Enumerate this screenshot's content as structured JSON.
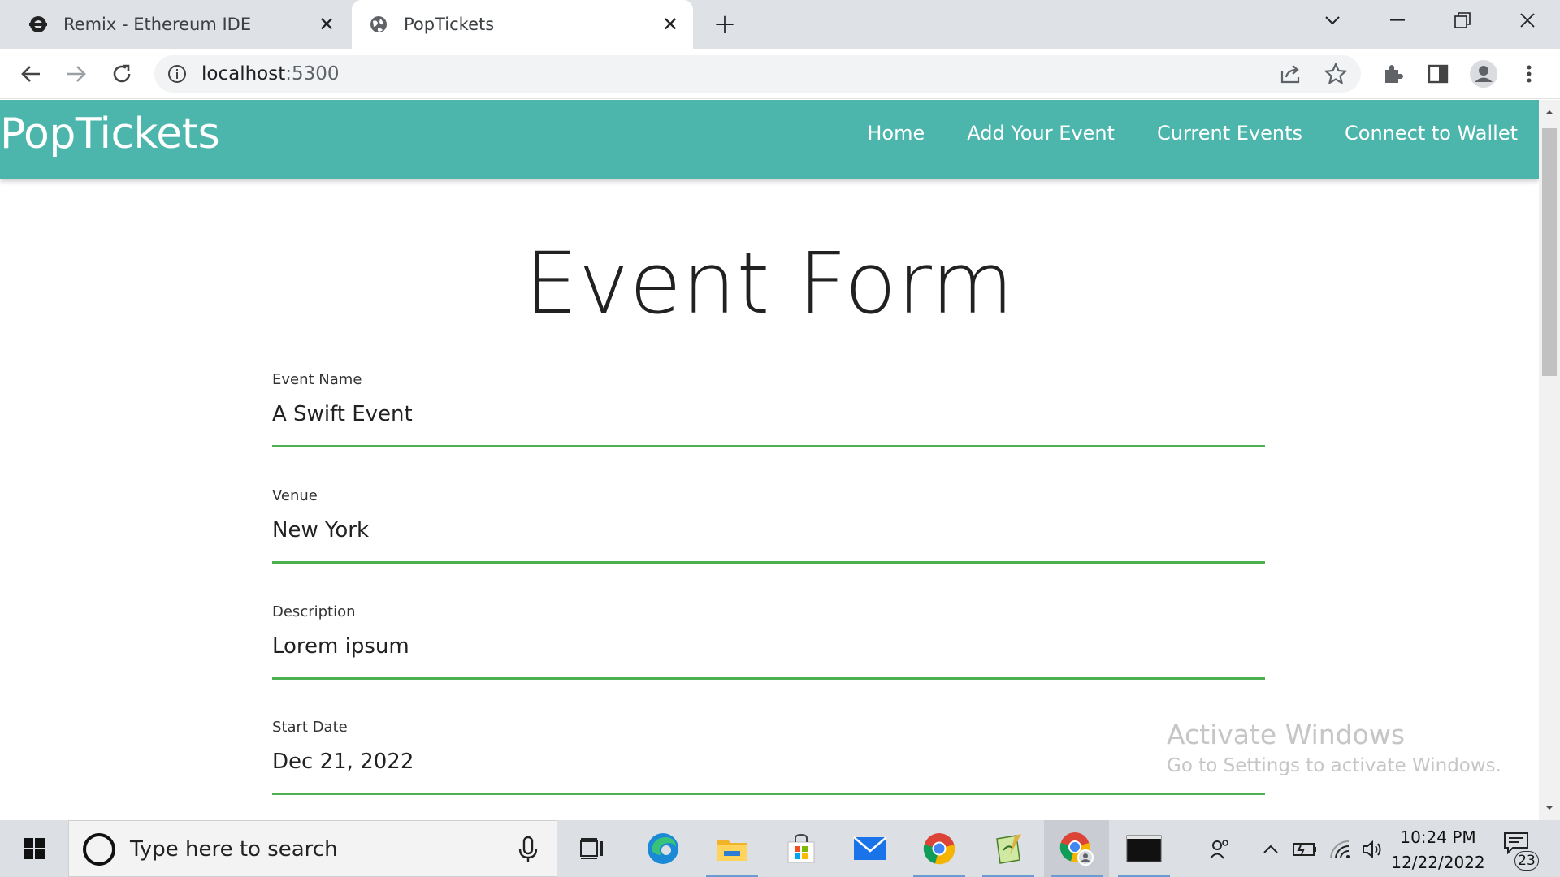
{
  "browser": {
    "tabs": [
      {
        "title": "Remix - Ethereum IDE",
        "active": false,
        "icon": "remix-icon"
      },
      {
        "title": "PopTickets",
        "active": true,
        "icon": "globe-icon"
      }
    ],
    "address": {
      "host": "localhost",
      "port": ":5300"
    }
  },
  "site": {
    "brand": "PopTickets",
    "nav": [
      "Home",
      "Add Your Event",
      "Current Events",
      "Connect to Wallet"
    ],
    "colors": {
      "navbar": "#4db6ac",
      "field_underline": "#4caf50"
    }
  },
  "form": {
    "title": "Event Form",
    "fields": [
      {
        "label": "Event Name",
        "value": "A Swift Event"
      },
      {
        "label": "Venue",
        "value": "New York"
      },
      {
        "label": "Description",
        "value": "Lorem ipsum"
      },
      {
        "label": "Start Date",
        "value": "Dec 21, 2022"
      }
    ]
  },
  "watermark": {
    "line1": "Activate Windows",
    "line2": "Go to Settings to activate Windows."
  },
  "taskbar": {
    "search_placeholder": "Type here to search",
    "time": "10:24 PM",
    "date": "12/22/2022",
    "notification_count": "23"
  }
}
